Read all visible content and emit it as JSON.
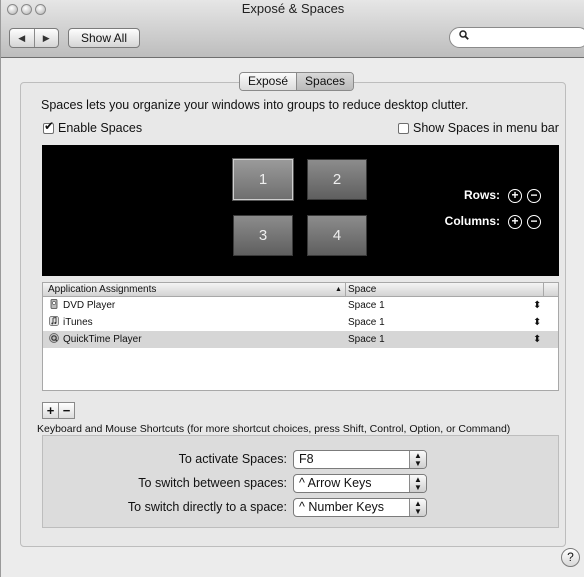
{
  "window": {
    "title": "Exposé & Spaces"
  },
  "toolbar": {
    "back_icon": "◀",
    "forward_icon": "▶",
    "show_all_label": "Show All",
    "search_icon": "🔍",
    "search_value": ""
  },
  "tabs": [
    {
      "label": "Exposé",
      "selected": false
    },
    {
      "label": "Spaces",
      "selected": true
    }
  ],
  "description": "Spaces lets you organize your windows into groups to reduce desktop clutter.",
  "enable_spaces": {
    "label": "Enable Spaces",
    "checked": true
  },
  "show_in_menu_bar": {
    "label": "Show Spaces in menu bar",
    "checked": false
  },
  "spaces_grid": {
    "tiles": [
      "1",
      "2",
      "3",
      "4"
    ],
    "selected": "1",
    "rows_label": "Rows:",
    "columns_label": "Columns:"
  },
  "assignments": {
    "headers": {
      "app": "Application Assignments",
      "space": "Space"
    },
    "rows": [
      {
        "app": "DVD Player",
        "icon": "dvd-player-icon",
        "space": "Space 1",
        "selected": false
      },
      {
        "app": "iTunes",
        "icon": "itunes-icon",
        "space": "Space 1",
        "selected": false
      },
      {
        "app": "QuickTime Player",
        "icon": "quicktime-icon",
        "space": "Space 1",
        "selected": true
      }
    ],
    "add_label": "+",
    "remove_label": "−"
  },
  "shortcuts": {
    "heading": "Keyboard and Mouse Shortcuts (for more shortcut choices, press Shift, Control, Option, or Command)",
    "items": [
      {
        "label": "To activate Spaces:",
        "value": "F8"
      },
      {
        "label": "To switch between spaces:",
        "value": "^ Arrow Keys"
      },
      {
        "label": "To switch directly to a space:",
        "value": "^ Number Keys"
      }
    ]
  },
  "help_label": "?"
}
